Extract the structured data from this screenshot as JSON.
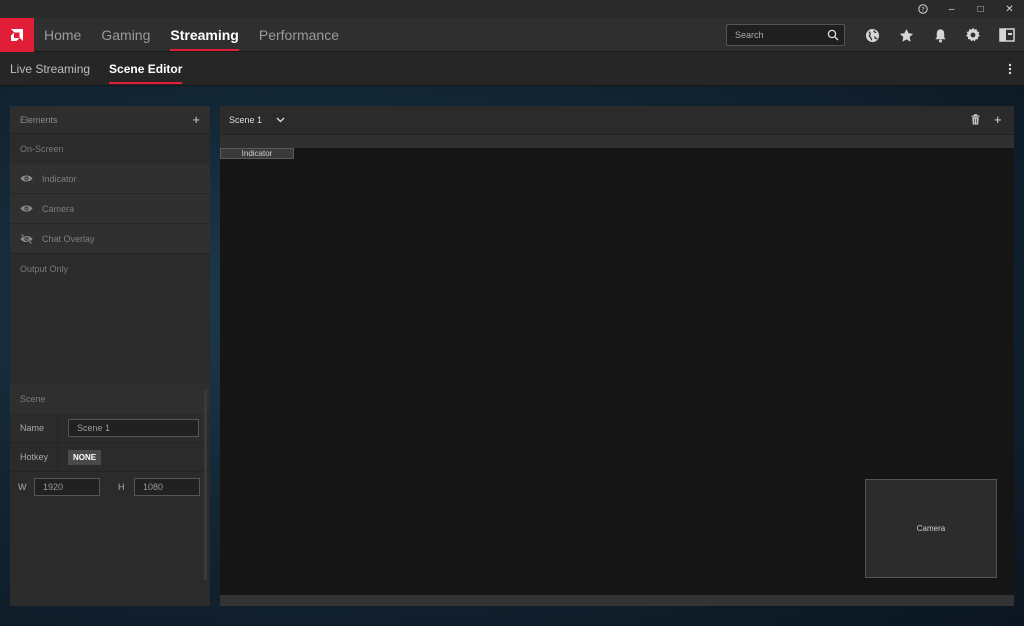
{
  "window_controls": {
    "help": "?",
    "minimize": "–",
    "maximize": "□",
    "close": "✕"
  },
  "nav": {
    "logo_icon": "amd-logo-icon",
    "items": [
      {
        "label": "Home",
        "active": false
      },
      {
        "label": "Gaming",
        "active": false
      },
      {
        "label": "Streaming",
        "active": true
      },
      {
        "label": "Performance",
        "active": false
      }
    ],
    "search_placeholder": "Search",
    "icons": [
      "globe-icon",
      "star-icon",
      "bell-icon",
      "gear-icon",
      "sidebar-icon"
    ]
  },
  "subnav": {
    "items": [
      {
        "label": "Live Streaming",
        "active": false
      },
      {
        "label": "Scene Editor",
        "active": true
      }
    ]
  },
  "elements_panel": {
    "title": "Elements",
    "add_label": "+",
    "on_screen_label": "On-Screen",
    "items": [
      {
        "label": "Indicator",
        "visible": true
      },
      {
        "label": "Camera",
        "visible": true
      },
      {
        "label": "Chat Overlay",
        "visible": false
      }
    ],
    "output_only_label": "Output Only"
  },
  "scene_panel": {
    "title": "Scene",
    "name_label": "Name",
    "name_value": "Scene 1",
    "hotkey_label": "Hotkey",
    "hotkey_value": "NONE",
    "w_label": "W",
    "w_value": "1920",
    "h_label": "H",
    "h_value": "1080"
  },
  "editor": {
    "scene_select": "Scene 1",
    "add_label": "+",
    "indicator_label": "Indicator",
    "camera_label": "Camera"
  },
  "colors": {
    "accent": "#e01e37",
    "panel": "#2b2b2b",
    "canvas": "#151515"
  }
}
